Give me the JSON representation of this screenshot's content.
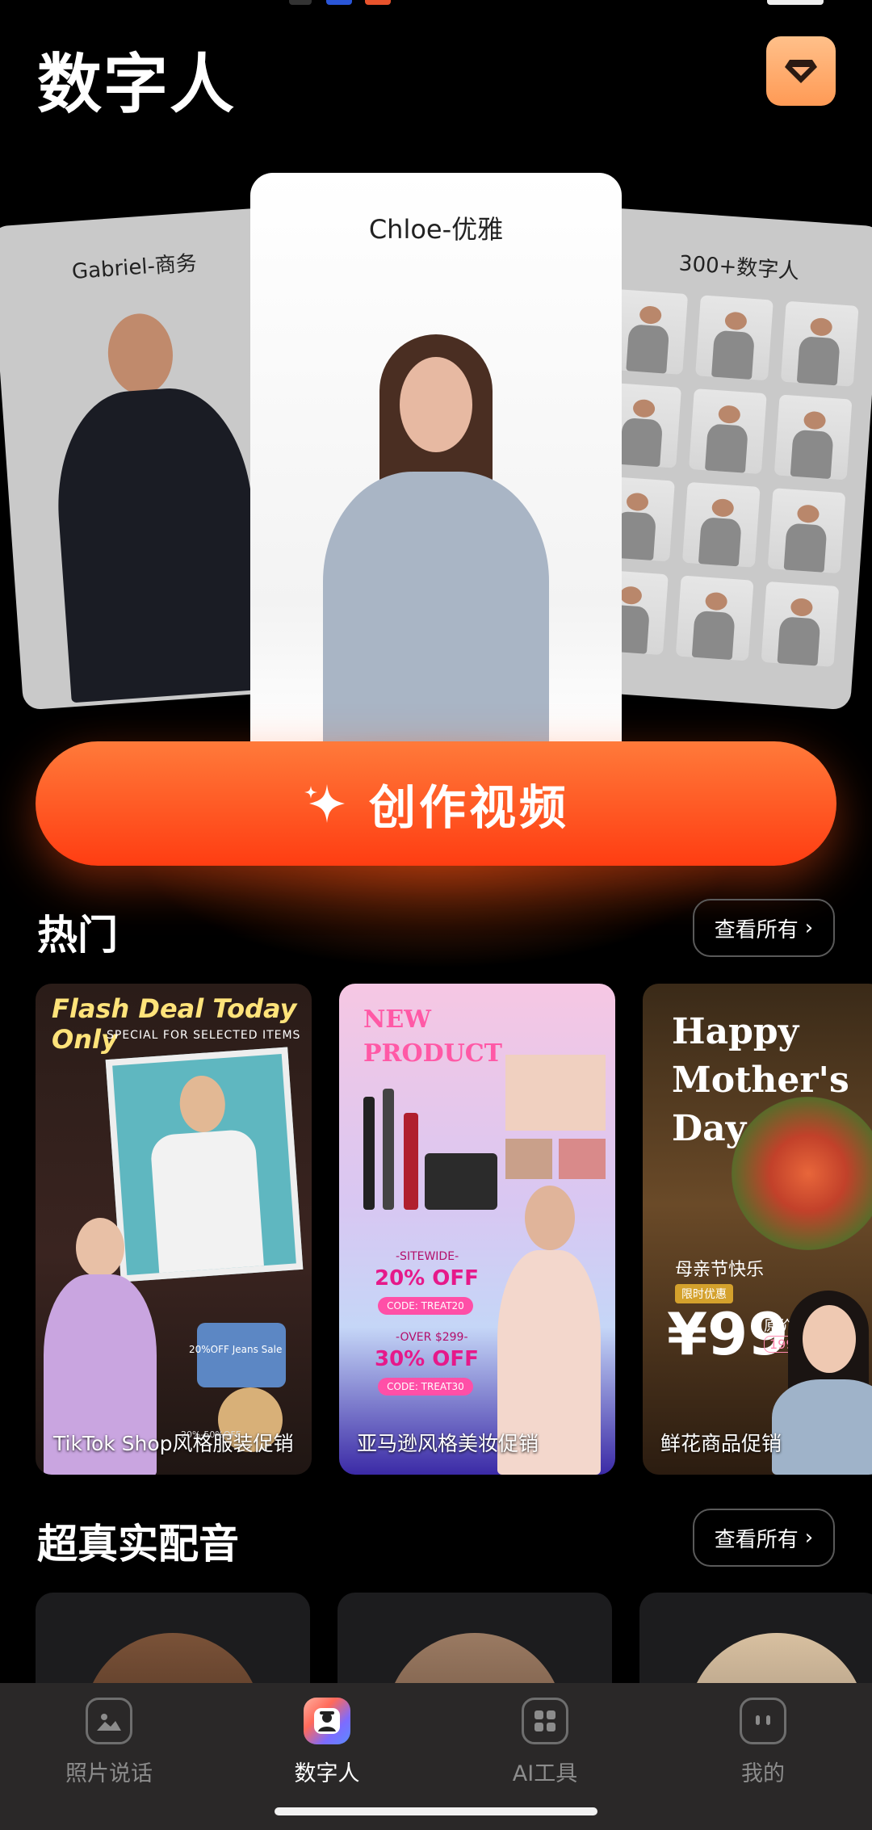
{
  "header": {
    "title": "数字人",
    "vip_icon": "diamond-icon"
  },
  "carousel": {
    "cards": [
      {
        "label": "Gabriel-商务"
      },
      {
        "label": "Chloe-优雅"
      },
      {
        "label": "300+数字人"
      }
    ]
  },
  "create_button": {
    "label": "创作视频",
    "icon": "sparkle-icon"
  },
  "hot": {
    "title": "热门",
    "see_all": "查看所有",
    "items": [
      {
        "caption": "TikTok Shop风格服装促销",
        "headline": "Flash Deal Today Only",
        "subline": "SPECIAL FOR SELECTED ITEMS",
        "tag": "20%OFF  Jeans Sale",
        "tag2": "20%-50%OFF"
      },
      {
        "caption": "亚马逊风格美妆促销",
        "headline_line1": "NEW",
        "headline_line2": "PRODUCT",
        "offer1_small": "-SITEWIDE-",
        "offer1": "20% OFF",
        "code1": "CODE: TREAT20",
        "offer2_small": "-OVER $299-",
        "offer2": "30% OFF",
        "code2": "CODE: TREAT30"
      },
      {
        "caption": "鲜花商品促销",
        "headline_line1": "Happy",
        "headline_line2": "Mother's",
        "headline_line3": "Day",
        "sub": "母亲节快乐",
        "badge": "限时优惠",
        "price": "¥99",
        "price_label": "原价",
        "price_old": "199"
      }
    ]
  },
  "voice": {
    "title": "超真实配音",
    "see_all": "查看所有"
  },
  "tabbar": {
    "tabs": [
      {
        "label": "照片说话",
        "icon": "image-icon"
      },
      {
        "label": "数字人",
        "icon": "digital-human-icon",
        "active": true
      },
      {
        "label": "AI工具",
        "icon": "grid-icon"
      },
      {
        "label": "我的",
        "icon": "profile-icon"
      }
    ]
  },
  "colors": {
    "accent": "#ff4a1c",
    "vip": "#ffae70",
    "background": "#000000",
    "tabbar": "#2a2828"
  }
}
